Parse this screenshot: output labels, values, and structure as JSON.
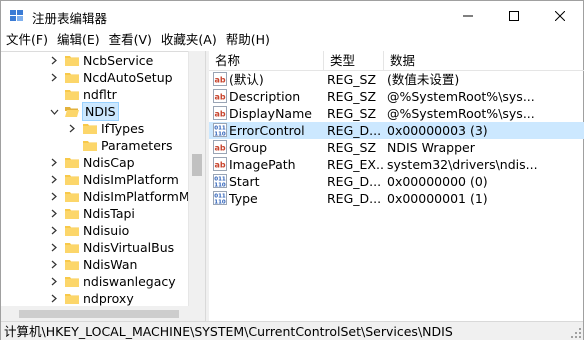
{
  "window": {
    "title": "注册表编辑器",
    "minimize_icon": "minimize-icon",
    "maximize_icon": "maximize-icon",
    "close_icon": "close-icon"
  },
  "menu": {
    "items": [
      "文件(F)",
      "编辑(E)",
      "查看(V)",
      "收藏夹(A)",
      "帮助(H)"
    ]
  },
  "tree": {
    "items": [
      {
        "label": "NcbService",
        "expander": "collapsed"
      },
      {
        "label": "NcdAutoSetup",
        "expander": "collapsed"
      },
      {
        "label": "ndfltr",
        "expander": "none"
      },
      {
        "label": "NDIS",
        "expander": "expanded",
        "selected": true
      },
      {
        "label": "IfTypes",
        "expander": "collapsed"
      },
      {
        "label": "Parameters",
        "expander": "none"
      },
      {
        "label": "NdisCap",
        "expander": "collapsed"
      },
      {
        "label": "NdisImPlatform",
        "expander": "collapsed"
      },
      {
        "label": "NdisImPlatformMp",
        "expander": "collapsed"
      },
      {
        "label": "NdisTapi",
        "expander": "collapsed"
      },
      {
        "label": "Ndisuio",
        "expander": "collapsed"
      },
      {
        "label": "NdisVirtualBus",
        "expander": "collapsed"
      },
      {
        "label": "NdisWan",
        "expander": "collapsed"
      },
      {
        "label": "ndiswanlegacy",
        "expander": "collapsed"
      },
      {
        "label": "ndproxy",
        "expander": "collapsed"
      }
    ]
  },
  "list": {
    "headers": {
      "name": "名称",
      "type": "类型",
      "data": "数据"
    },
    "rows": [
      {
        "name": "(默认)",
        "type": "REG_SZ",
        "data": "(数值未设置)",
        "icon": "string-value-icon"
      },
      {
        "name": "Description",
        "type": "REG_SZ",
        "data": "@%SystemRoot%\\sys...",
        "icon": "string-value-icon"
      },
      {
        "name": "DisplayName",
        "type": "REG_SZ",
        "data": "@%SystemRoot%\\sys...",
        "icon": "string-value-icon"
      },
      {
        "name": "ErrorControl",
        "type": "REG_D...",
        "data": "0x00000003 (3)",
        "icon": "binary-value-icon",
        "selected": true
      },
      {
        "name": "Group",
        "type": "REG_SZ",
        "data": "NDIS Wrapper",
        "icon": "string-value-icon"
      },
      {
        "name": "ImagePath",
        "type": "REG_EX...",
        "data": "system32\\drivers\\ndis...",
        "icon": "string-value-icon"
      },
      {
        "name": "Start",
        "type": "REG_D...",
        "data": "0x00000000 (0)",
        "icon": "binary-value-icon"
      },
      {
        "name": "Type",
        "type": "REG_D...",
        "data": "0x00000001 (1)",
        "icon": "binary-value-icon"
      }
    ]
  },
  "status": {
    "path": "计算机\\HKEY_LOCAL_MACHINE\\SYSTEM\\CurrentControlSet\\Services\\NDIS"
  },
  "colors": {
    "selection": "#cce8ff",
    "folder": "#f8c94a",
    "string_icon": "#c8452f",
    "binary_icon": "#2b5fb8"
  }
}
